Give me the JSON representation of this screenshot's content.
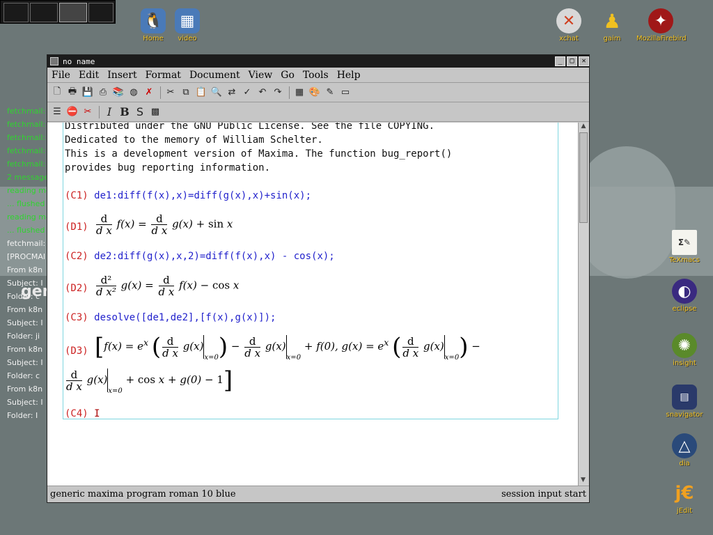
{
  "desktop": {
    "icons": [
      {
        "label": "Home",
        "icon": "tux-icon"
      },
      {
        "label": "video",
        "icon": "film-icon"
      },
      {
        "label": "xchat",
        "icon": "xchat-icon"
      },
      {
        "label": "gaim",
        "icon": "gaim-icon"
      },
      {
        "label": "MozillaFirebird",
        "icon": "firebird-icon"
      },
      {
        "label": "TeXmacs",
        "icon": "texmacs-icon"
      },
      {
        "label": "eclipse",
        "icon": "eclipse-icon"
      },
      {
        "label": "insight",
        "icon": "insight-icon"
      },
      {
        "label": "snavigator",
        "icon": "snavigator-icon"
      },
      {
        "label": "dia",
        "icon": "dia-icon"
      },
      {
        "label": "jEdit",
        "icon": "jedit-icon"
      }
    ],
    "overlay_text": "gen",
    "console_lines": [
      {
        "text": "fetchmail:",
        "color": "#2fd52f"
      },
      {
        "text": "fetchmail:",
        "color": "#2fd52f"
      },
      {
        "text": "fetchmail:",
        "color": "#2fd52f"
      },
      {
        "text": "fetchmail:",
        "color": "#2fd52f"
      },
      {
        "text": "fetchmail:",
        "color": "#2fd52f"
      },
      {
        "text": "2 message",
        "color": "#2fd52f"
      },
      {
        "text": "reading me",
        "color": "#2fd52f"
      },
      {
        "text": "... flushed",
        "color": "#2fd52f"
      },
      {
        "text": "reading me",
        "color": "#2fd52f"
      },
      {
        "text": "... flushed",
        "color": "#2fd52f"
      },
      {
        "text": "fetchmail:",
        "color": "#f2f2f2"
      },
      {
        "text": "[PROCMAI",
        "color": "#f2f2f2"
      },
      {
        "text": "From k8n",
        "color": "#f2f2f2"
      },
      {
        "text": " Subject: I",
        "color": "#f2f2f2"
      },
      {
        "text": "  Folder: c",
        "color": "#f2f2f2"
      },
      {
        "text": "From k8n",
        "color": "#f2f2f2"
      },
      {
        "text": " Subject: I",
        "color": "#f2f2f2"
      },
      {
        "text": "  Folder: ji",
        "color": "#f2f2f2"
      },
      {
        "text": "From k8n",
        "color": "#f2f2f2"
      },
      {
        "text": " Subject: I",
        "color": "#f2f2f2"
      },
      {
        "text": "  Folder: c",
        "color": "#f2f2f2"
      },
      {
        "text": "From k8n",
        "color": "#f2f2f2"
      },
      {
        "text": " Subject: I",
        "color": "#f2f2f2"
      },
      {
        "text": "  Folder: I",
        "color": "#f2f2f2"
      }
    ]
  },
  "window": {
    "title": "no name",
    "menu": [
      "File",
      "Edit",
      "Insert",
      "Format",
      "Document",
      "View",
      "Go",
      "Tools",
      "Help"
    ],
    "toolbar_icons": [
      "new-doc-icon",
      "open-icon",
      "save-icon",
      "print-icon",
      "books-icon",
      "globe-icon",
      "close-x-icon",
      "cut-icon",
      "copy-icon",
      "paste-icon",
      "find-icon",
      "replace-icon",
      "spell-icon",
      "undo-icon",
      "redo-icon",
      "table-icon",
      "paint-icon",
      "pen-icon",
      "fullscreen-icon"
    ],
    "format_icons": [
      "align-icon",
      "stop-icon",
      "scissors-icon"
    ],
    "format_buttons": {
      "italic": "I",
      "bold": "B",
      "sans": "S"
    },
    "status_left": "generic maxima program roman 10 blue",
    "status_right": "session input start"
  },
  "document": {
    "header_lines": [
      "Distributed under the GNU Public License. See the file COPYING.",
      "Dedicated to the memory of William Schelter.",
      "This is a development version of Maxima. The function bug_report()",
      "provides bug reporting information."
    ],
    "c1": {
      "label": "(C1)",
      "input": "de1:diff(f(x),x)=diff(g(x),x)+sin(x);"
    },
    "d1": {
      "label": "(D1)"
    },
    "c2": {
      "label": "(C2)",
      "input": "de2:diff(g(x),x,2)=diff(f(x),x) - cos(x);"
    },
    "d2": {
      "label": "(D2)"
    },
    "c3": {
      "label": "(C3)",
      "input": "desolve([de1,de2],[f(x),g(x)]);"
    },
    "d3": {
      "label": "(D3)"
    },
    "c4": {
      "label": "(C4)",
      "cursor": "I"
    },
    "colors": {
      "input": "#2222cc",
      "label": "#cc2222",
      "session_border": "#7fd6e0"
    }
  }
}
